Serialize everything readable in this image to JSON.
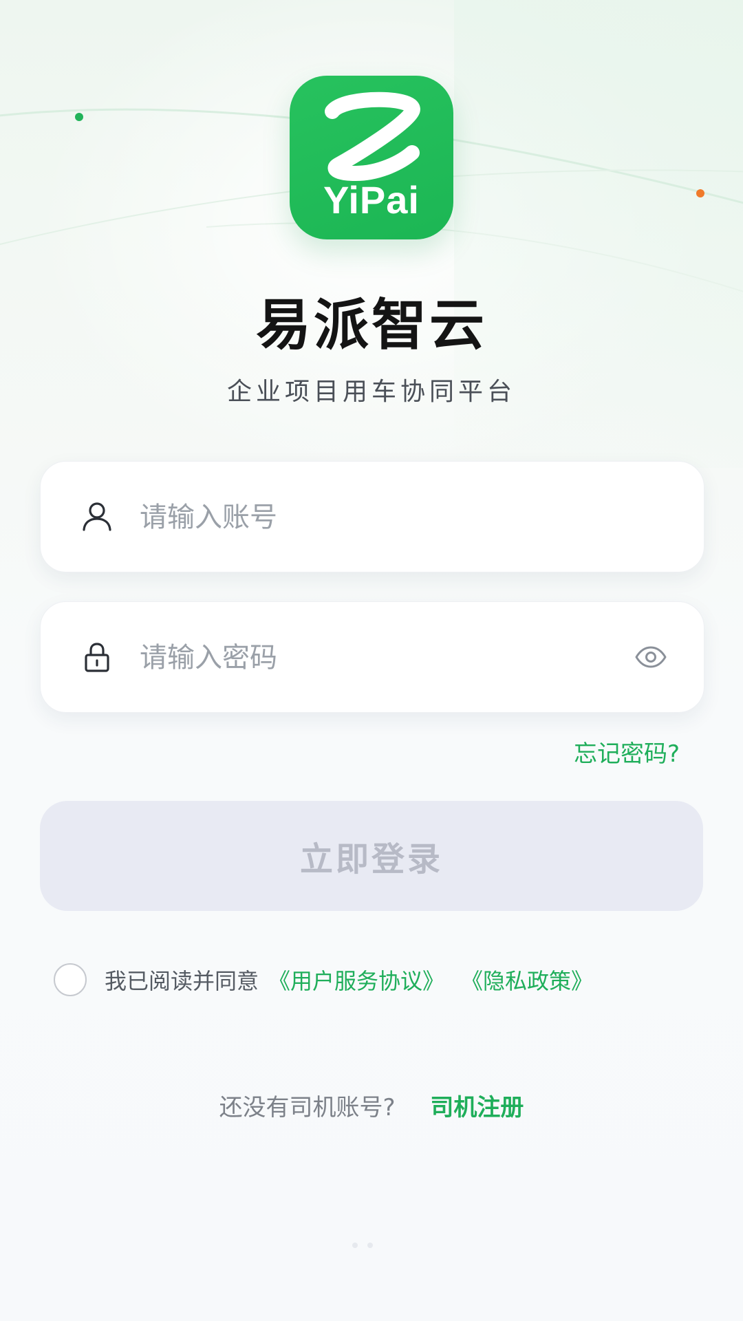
{
  "logo": {
    "text": "YiPai",
    "brand_color": "#1fb855",
    "icon": "z-logo-icon"
  },
  "app": {
    "name": "易派智云",
    "subtitle": "企业项目用车协同平台"
  },
  "form": {
    "account_placeholder": "请输入账号",
    "password_placeholder": "请输入密码",
    "account_icon": "user-icon",
    "password_icon": "lock-icon",
    "visibility_icon": "eye-icon",
    "forgot_label": "忘记密码?",
    "login_label": "立即登录"
  },
  "agreement": {
    "prefix": "我已阅读并同意",
    "terms_label": "《用户服务协议》",
    "privacy_label": "《隐私政策》",
    "checked": false
  },
  "register": {
    "question": "还没有司机账号?",
    "link_label": "司机注册"
  },
  "colors": {
    "accent": "#1fae5a",
    "button_disabled_bg": "#e8eaf3",
    "button_disabled_text": "#b7bac6"
  }
}
